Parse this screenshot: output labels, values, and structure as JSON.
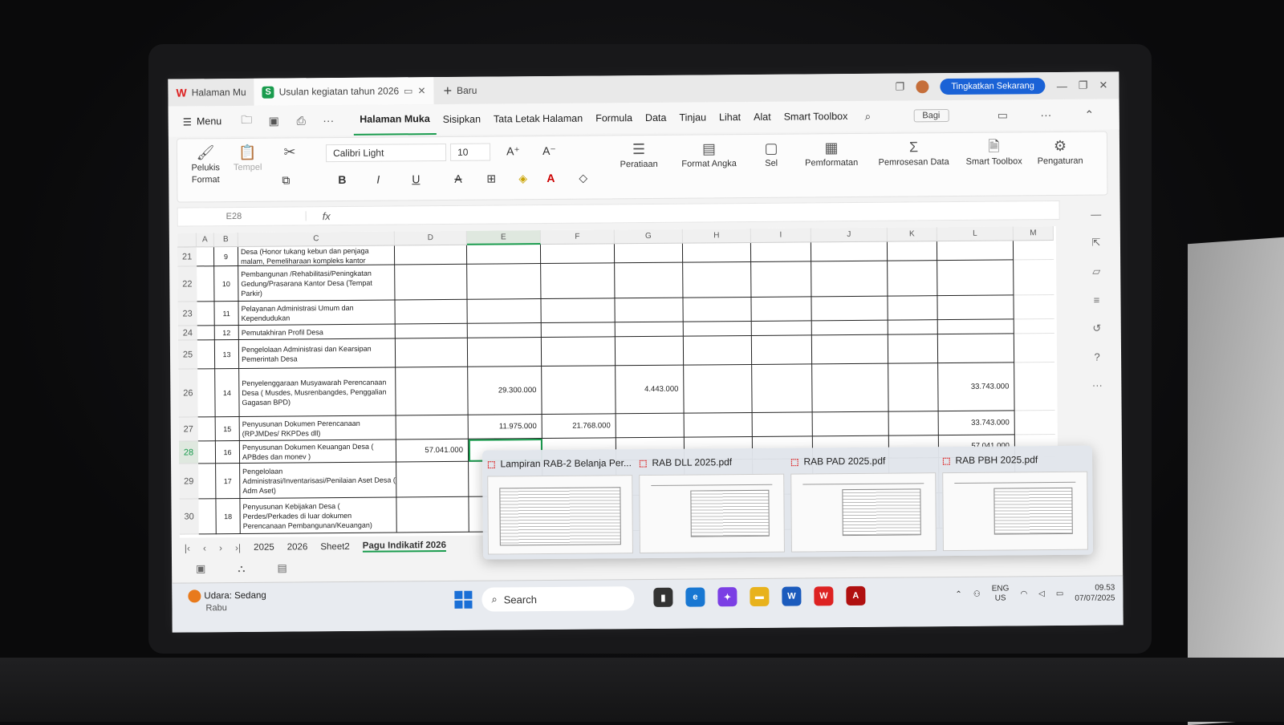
{
  "tabs": {
    "home_label": "Halaman Mu",
    "doc_label": "Usulan kegiatan tahun 2026",
    "new_label": "Baru",
    "upgrade_label": "Tingkatkan Sekarang"
  },
  "menu": {
    "menu_label": "Menu",
    "items": [
      "Halaman Muka",
      "Sisipkan",
      "Tata Letak Halaman",
      "Formula",
      "Data",
      "Tinjau",
      "Lihat",
      "Alat",
      "Smart Toolbox"
    ],
    "share_label": "Bagi"
  },
  "ribbon": {
    "format_painter": "Pelukis Format",
    "paste": "Tempel",
    "font_name": "Calibri Light",
    "font_size": "10",
    "alignment": "Peratiaan",
    "number_format": "Format Angka",
    "cell": "Sel",
    "conditional": "Pemformatan",
    "data_processing": "Pemrosesan Data",
    "smart_toolbox": "Smart Toolbox",
    "settings": "Pengaturan"
  },
  "formula_bar": {
    "name_box": "E28",
    "fx": "fx"
  },
  "columns": [
    "A",
    "B",
    "C",
    "D",
    "E",
    "F",
    "G",
    "H",
    "I",
    "J",
    "K",
    "L",
    "M"
  ],
  "rows": [
    {
      "row": "21",
      "no": "9",
      "desc": "Desa (Honor tukang kebun dan penjaga malam, Pemeliharaan kompleks kantor",
      "d": "",
      "e": "",
      "f": "",
      "g": "",
      "l": ""
    },
    {
      "row": "22",
      "no": "10",
      "desc": "Pembangunan /Rehabilitasi/Peningkatan Gedung/Prasarana Kantor Desa (Tempat Parkir)",
      "d": "",
      "e": "",
      "f": "",
      "g": "",
      "l": ""
    },
    {
      "row": "23",
      "no": "11",
      "desc": "Pelayanan Administrasi Umum dan Kependudukan",
      "d": "",
      "e": "",
      "f": "",
      "g": "",
      "l": ""
    },
    {
      "row": "24",
      "no": "12",
      "desc": "Pemutakhiran Profil Desa",
      "d": "",
      "e": "",
      "f": "",
      "g": "",
      "l": ""
    },
    {
      "row": "25",
      "no": "13",
      "desc": "Pengelolaan Administrasi dan Kearsipan Pemerintah Desa",
      "d": "",
      "e": "",
      "f": "",
      "g": "",
      "l": ""
    },
    {
      "row": "26",
      "no": "14",
      "desc": "Penyelenggaraan Musyawarah Perencanaan Desa ( Musdes, Musrenbangdes, Penggalian Gagasan BPD)",
      "d": "",
      "e": "29.300.000",
      "f": "",
      "g": "4.443.000",
      "l": "33.743.000"
    },
    {
      "row": "27",
      "no": "15",
      "desc": "Penyusunan Dokumen Perencanaan (RPJMDes/ RKPDes dll)",
      "d": "",
      "e": "11.975.000",
      "f": "21.768.000",
      "g": "",
      "l": "33.743.000"
    },
    {
      "row": "28",
      "no": "16",
      "desc": "Penyusunan Dokumen Keuangan Desa ( APBdes dan monev )",
      "d": "57.041.000",
      "e": "",
      "f": "",
      "g": "",
      "l": "57.041.000"
    },
    {
      "row": "29",
      "no": "17",
      "desc": "Pengelolaan Administrasi/Inventarisasi/Penilaian Aset Desa ( Adm Aset)",
      "d": "",
      "e": "",
      "f": "",
      "g": "",
      "l": ""
    },
    {
      "row": "30",
      "no": "18",
      "desc": "Penyusunan Kebijakan Desa ( Perdes/Perkades di luar dokumen Perencanaan Pembangunan/Keuangan)",
      "d": "",
      "e": "",
      "f": "",
      "g": "",
      "l": ""
    }
  ],
  "sheets": [
    "2025",
    "2026",
    "Sheet2",
    "Pagu Indikatif 2026"
  ],
  "thumbnails": [
    "Lampiran RAB-2 Belanja Per...",
    "RAB DLL 2025.pdf",
    "RAB PAD 2025.pdf",
    "RAB PBH 2025.pdf"
  ],
  "taskbar": {
    "weather_title": "Udara: Sedang",
    "weather_day": "Rabu",
    "search_label": "Search",
    "lang_top": "ENG",
    "lang_bottom": "US",
    "time": "09.53",
    "date": "07/07/2025"
  }
}
